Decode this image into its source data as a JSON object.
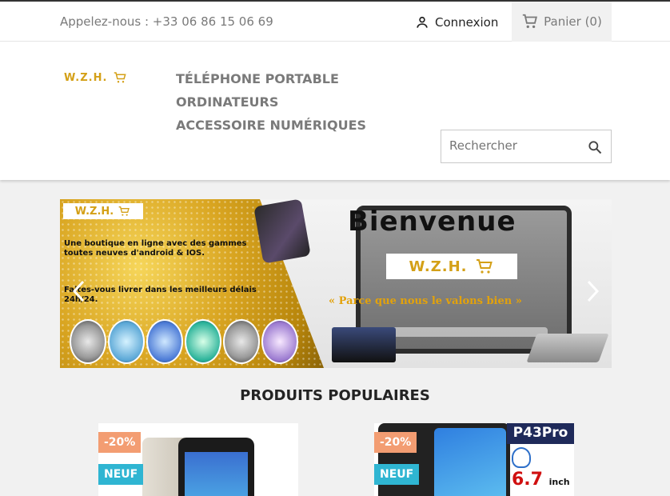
{
  "topbar": {
    "phone_text": "Appelez-nous : +33 06 86 15 06 69",
    "login_label": "Connexion",
    "cart_label": "Panier (0)"
  },
  "header": {
    "logo_text": "W.Z.H.",
    "menu": [
      "TÉLÉPHONE PORTABLE",
      "ORDINATEURS",
      "ACCESSOIRE NUMÉRIQUES"
    ],
    "search_placeholder": "Rechercher"
  },
  "banner": {
    "logo_text": "W.Z.H.",
    "title": "Bienvenue",
    "center_logo_text": "W.Z.H.",
    "tagline": "« Parce que nous le valons bien »",
    "line1": "Une boutique en ligne avec des gammes",
    "line2": "toutes neuves d'android & IOS.",
    "line3": "Faites-vous livrer dans les meilleurs délais",
    "line4": "24h/24."
  },
  "products": {
    "title": "PRODUITS POPULAIRES",
    "items": [
      {
        "discount": "-20%",
        "flag": "NEUF"
      },
      {
        "discount": "-20%",
        "flag": "NEUF",
        "model_label": "P43Pro",
        "size_label": "6.7",
        "size_unit": "inch"
      }
    ]
  },
  "colors": {
    "accent_new": "#2fb5d2",
    "accent_discount": "#f39d72",
    "logo_gold": "#d4a017"
  }
}
